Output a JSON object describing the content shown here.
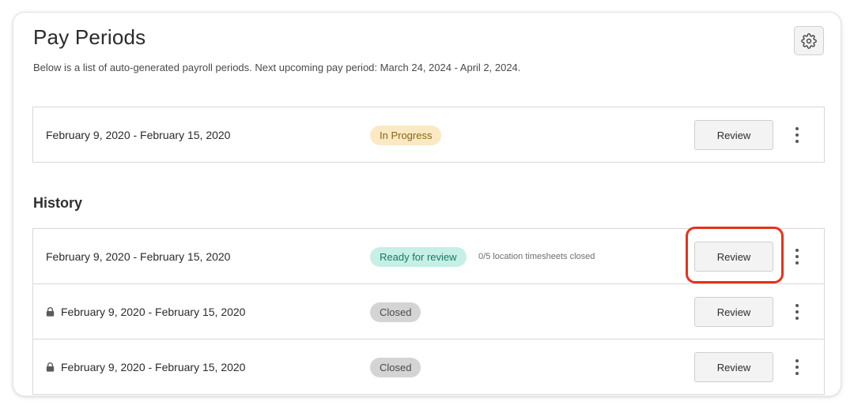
{
  "header": {
    "title": "Pay Periods",
    "subtitle": "Below is a list of auto-generated payroll periods. Next upcoming pay period: March 24, 2024 - April 2, 2024.",
    "settings_icon": "gear-icon"
  },
  "current": {
    "date_range": "February 9, 2020 - February 15, 2020",
    "status": "In Progress",
    "review_label": "Review",
    "status_color": "#fbe9c3"
  },
  "history": {
    "title": "History",
    "rows": [
      {
        "date_range": "February 9, 2020 - February 15, 2020",
        "status": "Ready for review",
        "note": "0/5 location timesheets closed",
        "review_label": "Review",
        "locked": false
      },
      {
        "date_range": "February 9, 2020 - February 15, 2020",
        "status": "Closed",
        "review_label": "Review",
        "locked": true
      },
      {
        "date_range": "February 9, 2020 - February 15, 2020",
        "status": "Closed",
        "review_label": "Review",
        "locked": true
      }
    ]
  },
  "colors": {
    "highlight": "#e5321b",
    "ready_badge": "#c6efe6",
    "closed_badge": "#d4d4d4"
  }
}
